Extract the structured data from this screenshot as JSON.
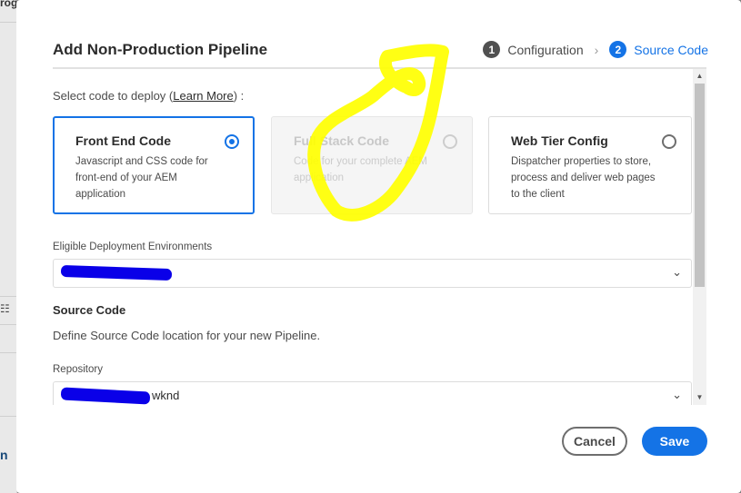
{
  "background": {
    "prog_fragment": "rog",
    "n_fragment": "n",
    "icon_name": "tree-icon"
  },
  "dialog": {
    "title": "Add Non-Production Pipeline",
    "steps": [
      {
        "number": "1",
        "label": "Configuration",
        "state": "done"
      },
      {
        "number": "2",
        "label": "Source Code",
        "state": "active"
      }
    ],
    "select_code": {
      "prefix": "Select code to deploy (",
      "link": "Learn More",
      "suffix": ") :"
    },
    "cards": [
      {
        "title": "Front End Code",
        "description": "Javascript and CSS code for front-end of your AEM application",
        "state": "selected"
      },
      {
        "title": "Full Stack Code",
        "description": "Code for your complete AEM application",
        "state": "disabled"
      },
      {
        "title": "Web Tier Config",
        "description": "Dispatcher properties to store, process and deliver web pages to the client",
        "state": "unselected"
      }
    ],
    "environments": {
      "label": "Eligible Deployment Environments",
      "value": "",
      "redacted": true
    },
    "source_code": {
      "title": "Source Code",
      "description": "Define Source Code location for your new Pipeline."
    },
    "repository": {
      "label": "Repository",
      "value": "wknd",
      "redacted_prefix": true
    },
    "buttons": {
      "cancel": "Cancel",
      "save": "Save"
    }
  },
  "colors": {
    "accent": "#1473e6",
    "annotation": "#ffff00",
    "redaction": "#0a00e8"
  }
}
